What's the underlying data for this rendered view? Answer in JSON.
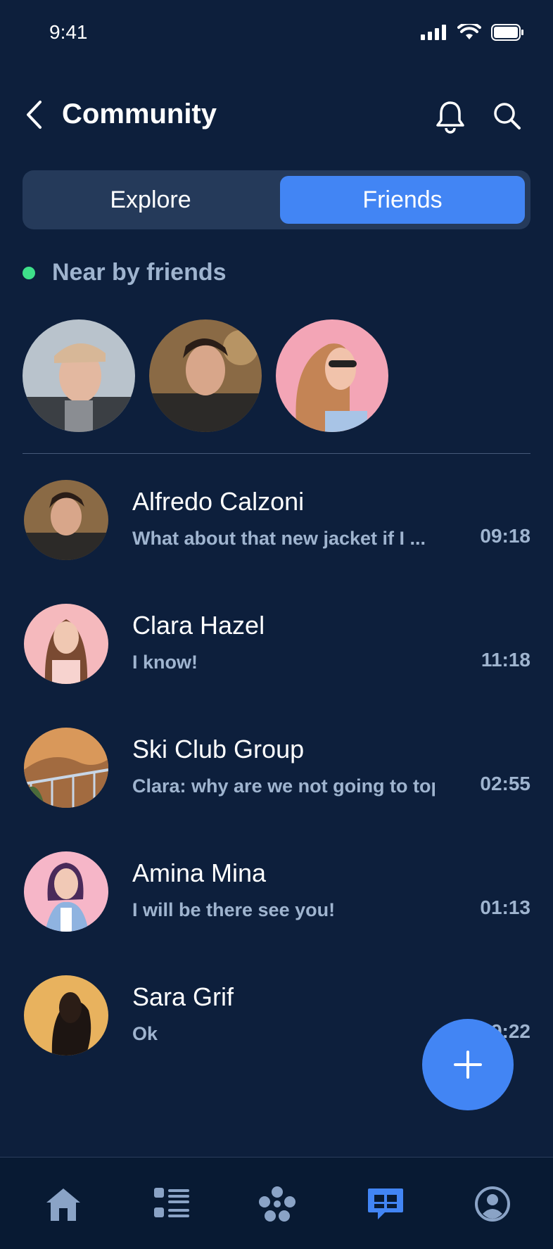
{
  "status_bar": {
    "time": "9:41"
  },
  "header": {
    "title": "Community"
  },
  "segment": {
    "explore_label": "Explore",
    "friends_label": "Friends",
    "active": "Friends"
  },
  "nearby": {
    "label": "Near by friends",
    "count": 3
  },
  "chats": [
    {
      "name": "Alfredo Calzoni",
      "preview": "What about that new jacket if I ...",
      "time": "09:18"
    },
    {
      "name": "Clara Hazel",
      "preview": "I know!",
      "time": "11:18"
    },
    {
      "name": "Ski Club Group",
      "preview": "Clara: why are we not going to top..",
      "time": "02:55"
    },
    {
      "name": "Amina Mina",
      "preview": "I will be there see you!",
      "time": "01:13"
    },
    {
      "name": "Sara Grif",
      "preview": "Ok",
      "time": "09:22"
    }
  ],
  "tabbar": {
    "items": [
      "home-icon",
      "list-icon",
      "apps-icon",
      "chat-icon",
      "profile-icon"
    ],
    "active": "chat-icon"
  },
  "colors": {
    "background": "#0d1f3c",
    "accent": "#4285f4",
    "online": "#3ee08a",
    "muted_text": "#9fb4cf",
    "segment_bg": "#253a5a",
    "tabbar_bg": "#081a33"
  }
}
